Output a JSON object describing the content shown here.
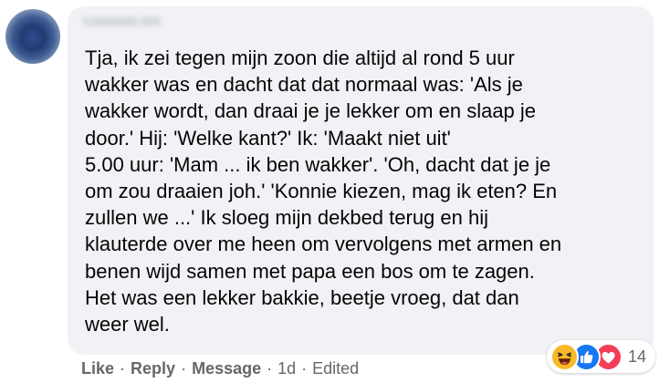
{
  "comment": {
    "author": "Lxxxxxxx xxx",
    "lines": [
      "Tja, ik zei tegen mijn zoon die altijd al rond 5 uur",
      "wakker was en dacht dat dat normaal was: 'Als je",
      "wakker wordt, dan draai je je lekker om en slaap je",
      "door.' Hij: 'Welke kant?' Ik: 'Maakt niet uit'",
      "5.00 uur: 'Mam ... ik ben wakker'. 'Oh, dacht dat je je",
      "om zou draaien joh.' 'Konnie kiezen, mag ik eten? En",
      "zullen we ...' Ik sloeg mijn dekbed terug en hij",
      "klauterde over me heen om vervolgens met armen en",
      "benen wijd samen met papa een bos om te zagen.",
      "Het was een lekker bakkie, beetje vroeg, dat dan",
      "weer wel."
    ]
  },
  "reactions": {
    "icons": [
      "haha-icon",
      "like-icon",
      "love-icon"
    ],
    "count": "14"
  },
  "actions": {
    "like": "Like",
    "reply": "Reply",
    "message": "Message",
    "separator": "·",
    "time": "1d",
    "edited": "Edited"
  },
  "colors": {
    "bubble": "#f0f2f5",
    "text": "#050505",
    "secondary": "#65676b",
    "like_blue": "#1877f2",
    "love_red": "#f33e58",
    "haha_yellow": "#f7b928"
  }
}
